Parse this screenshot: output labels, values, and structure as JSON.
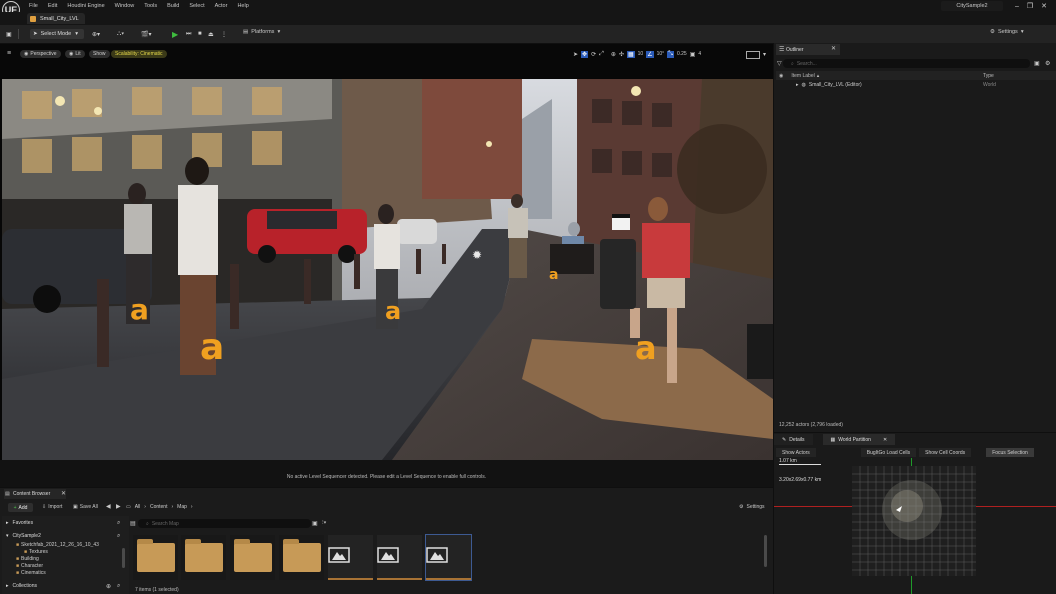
{
  "menubar": {
    "logo": "UE",
    "items": [
      "File",
      "Edit",
      "Houdini Engine",
      "Window",
      "Tools",
      "Build",
      "Select",
      "Actor",
      "Help"
    ],
    "project": "CitySample2",
    "window_controls": [
      "minimize-icon",
      "maximize-icon",
      "close-icon"
    ]
  },
  "level_tab": {
    "label": "Small_City_LVL"
  },
  "toolbar": {
    "select_mode": "Select Mode",
    "platforms": "Platforms",
    "settings": "Settings",
    "play_icon": "play-icon"
  },
  "viewport": {
    "perspective": "Perspective",
    "lit": "Lit",
    "show": "Show",
    "scalability": "Scalability: Cinematic",
    "grid_snap": "10",
    "rotate_snap": "10°",
    "scale_snap": "0.25",
    "camera_speed": "4",
    "sequencer_message": "No active Level Sequencer detected. Please edit a Level Sequence to enable full controls."
  },
  "outliner": {
    "tab": "Outliner",
    "search_placeholder": "Search...",
    "col_label": "Item Label",
    "col_type": "Type",
    "row_label": "Small_City_LVL (Editor)",
    "row_type": "World",
    "actors_status": "12,252 actors (2,796 loaded)"
  },
  "details": {
    "tab_details": "Details",
    "tab_world_partition": "World Partition",
    "show_actors": "Show Actors",
    "bugitgo": "BugItGo Load Cells",
    "show_cell_coords": "Show Cell Coords",
    "focus_selection": "Focus Selection",
    "scale_label": "1.07 km",
    "world_dims": "3.20x2.69x0.77 km"
  },
  "content_browser": {
    "tab": "Content Browser",
    "add": "Add",
    "import": "Import",
    "save_all": "Save All",
    "breadcrumb": [
      "All",
      "Content",
      "Map"
    ],
    "settings": "Settings",
    "favorites": "Favorites",
    "project": "CitySample2",
    "tree": [
      "Sketchfab_2021_12_26_16_10_43",
      "Textures",
      "Building",
      "Character",
      "Cinematics"
    ],
    "collections": "Collections",
    "search_placeholder": "Search Map",
    "items_status": "7 items (1 selected)",
    "assets": [
      {
        "kind": "folder"
      },
      {
        "kind": "folder"
      },
      {
        "kind": "folder"
      },
      {
        "kind": "folder"
      },
      {
        "kind": "level"
      },
      {
        "kind": "level"
      },
      {
        "kind": "level",
        "selected": true
      }
    ]
  }
}
